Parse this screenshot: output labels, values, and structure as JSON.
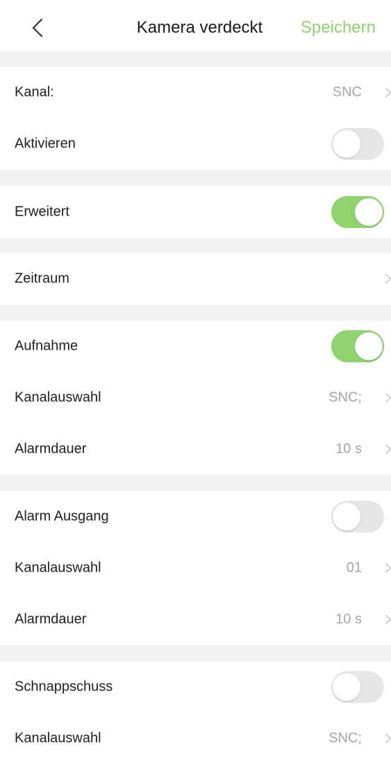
{
  "header": {
    "title": "Kamera verdeckt",
    "save_label": "Speichern",
    "accent_color": "#8fd36f"
  },
  "rows": {
    "kanal": {
      "label": "Kanal:",
      "value": "SNC"
    },
    "aktivieren": {
      "label": "Aktivieren",
      "toggle": false
    },
    "erweitert": {
      "label": "Erweitert",
      "toggle": true
    },
    "zeitraum": {
      "label": "Zeitraum"
    },
    "aufnahme": {
      "label": "Aufnahme",
      "toggle": true
    },
    "aufnahme_kanalauswahl": {
      "label": "Kanalauswahl",
      "value": "SNC;"
    },
    "aufnahme_alarmdauer": {
      "label": "Alarmdauer",
      "value": "10 s"
    },
    "alarm_ausgang": {
      "label": "Alarm Ausgang",
      "toggle": false
    },
    "ausgang_kanalauswahl": {
      "label": "Kanalauswahl",
      "value": "01"
    },
    "ausgang_alarmdauer": {
      "label": "Alarmdauer",
      "value": "10 s"
    },
    "schnappschuss": {
      "label": "Schnappschuss",
      "toggle": false
    },
    "schnappschuss_kanalauswahl": {
      "label": "Kanalauswahl",
      "value": "SNC;"
    }
  },
  "icons": {
    "back": "chevron-left-icon",
    "disclosure": "chevron-right-icon"
  }
}
